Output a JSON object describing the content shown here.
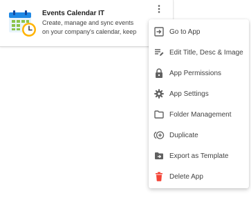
{
  "app_card": {
    "title": "Events Calendar IT",
    "description": "Create, manage and sync events on your company's calendar, keep ...",
    "icon": "calendar-clock-icon",
    "more_icon": "more-vert-icon"
  },
  "menu": {
    "items": [
      {
        "label": "Go to App",
        "icon": "open-in-app-icon"
      },
      {
        "label": "Edit Title, Desc & Image",
        "icon": "edit-notes-icon"
      },
      {
        "label": "App Permissions",
        "icon": "lock-icon"
      },
      {
        "label": "App Settings",
        "icon": "gear-icon"
      },
      {
        "label": "Folder Management",
        "icon": "folder-icon"
      },
      {
        "label": "Duplicate",
        "icon": "duplicate-icon"
      },
      {
        "label": "Export as Template",
        "icon": "folder-move-icon"
      },
      {
        "label": "Delete App",
        "icon": "trash-icon",
        "color": "#f44336"
      }
    ]
  }
}
